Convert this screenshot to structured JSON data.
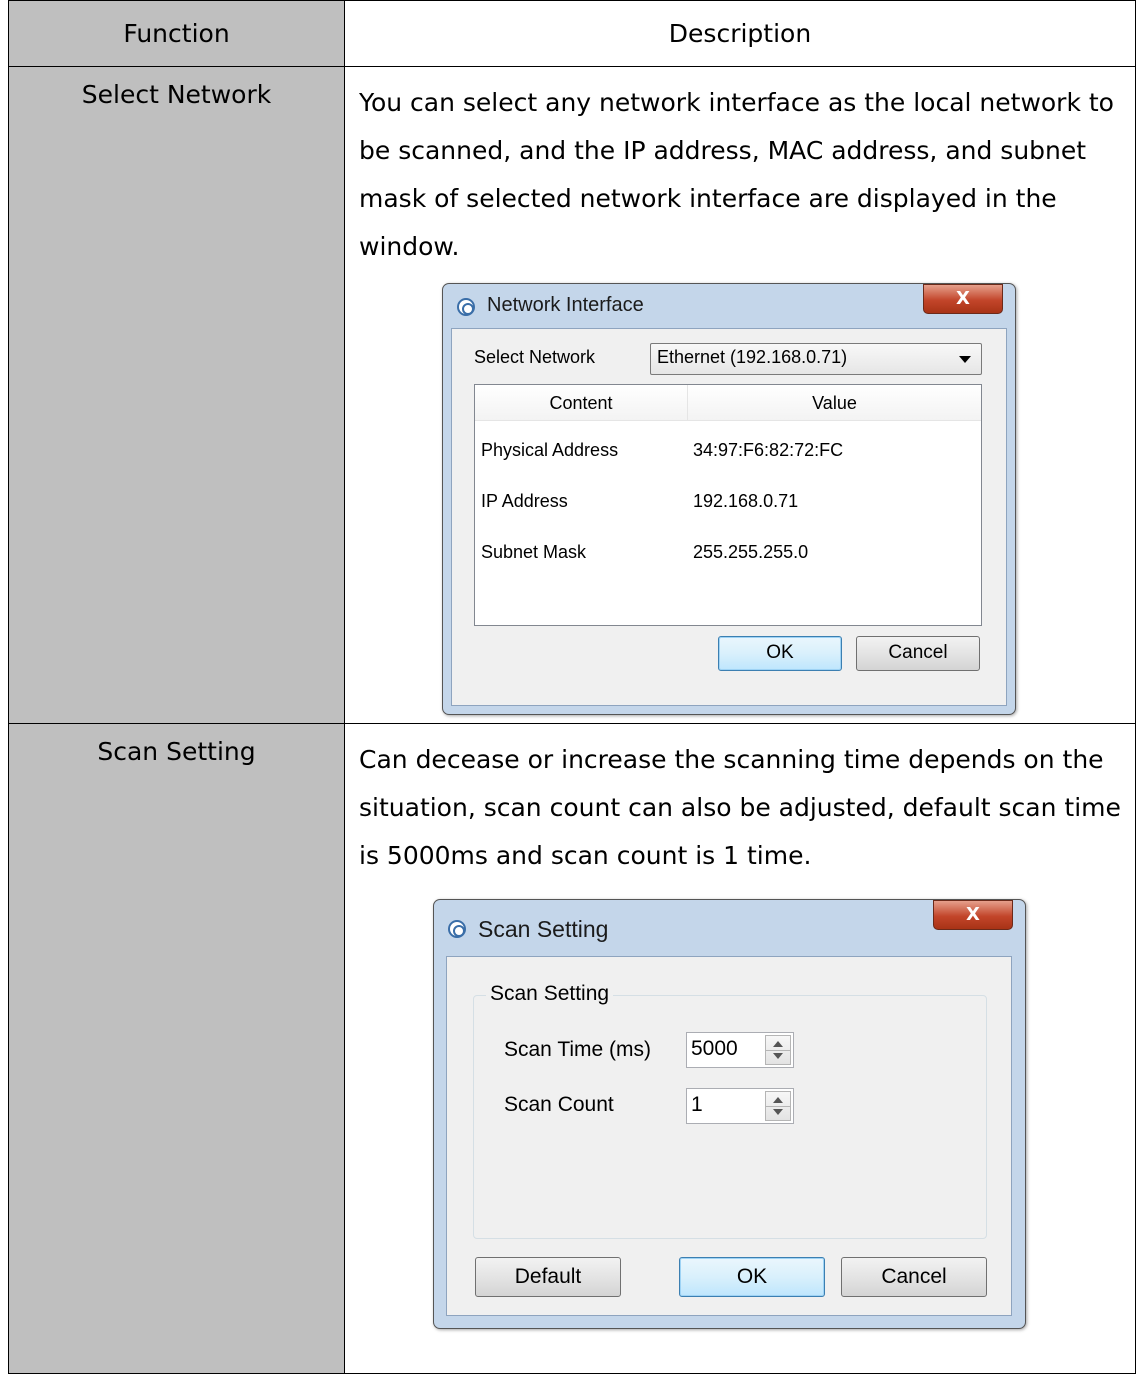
{
  "table": {
    "headers": {
      "function": "Function",
      "description": "Description"
    },
    "rows": [
      {
        "function": "Select Network",
        "description": "You can select any network interface as the local network to be scanned, and the IP address, MAC address, and subnet mask of selected network interface are displayed in the window."
      },
      {
        "function": "Scan Setting",
        "description": "Can decease or increase the scanning time depends on the situation, scan count can also be adjusted, default scan time is 5000ms and scan count is 1 time."
      }
    ]
  },
  "network_dialog": {
    "title": "Network Interface",
    "close_label": "X",
    "select_label": "Select Network",
    "select_value": "Ethernet (192.168.0.71)",
    "columns": [
      "Content",
      "Value"
    ],
    "rows": [
      {
        "content": "Physical Address",
        "value": "34:97:F6:82:72:FC"
      },
      {
        "content": "IP Address",
        "value": "192.168.0.71"
      },
      {
        "content": "Subnet Mask",
        "value": "255.255.255.0"
      }
    ],
    "ok_label": "OK",
    "cancel_label": "Cancel"
  },
  "scan_dialog": {
    "title": "Scan Setting",
    "close_label": "X",
    "group_caption": "Scan Setting",
    "scan_time_label": "Scan Time (ms)",
    "scan_time_value": "5000",
    "scan_count_label": "Scan Count",
    "scan_count_value": "1",
    "default_label": "Default",
    "ok_label": "OK",
    "cancel_label": "Cancel"
  }
}
